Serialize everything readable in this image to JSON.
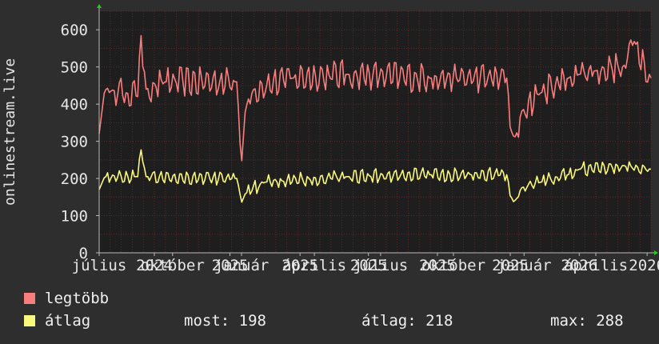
{
  "chart_data": {
    "type": "line",
    "ylabel": "onlinestream.live",
    "ylim": [
      0,
      650
    ],
    "yticks": [
      0,
      100,
      200,
      300,
      400,
      500,
      600
    ],
    "grid": true,
    "xticks": [
      {
        "label": "július",
        "pos": 0.0
      },
      {
        "label": "október",
        "pos": 0.133
      },
      {
        "label": "2024",
        "pos": 0.1
      },
      {
        "label": "január",
        "pos": 0.258
      },
      {
        "label": "2025",
        "pos": 0.237
      },
      {
        "label": "április",
        "pos": 0.39
      },
      {
        "label": "2025",
        "pos": 0.364
      },
      {
        "label": "július",
        "pos": 0.51
      },
      {
        "label": "2025",
        "pos": 0.488
      },
      {
        "label": "október",
        "pos": 0.642
      },
      {
        "label": "2025",
        "pos": 0.613
      },
      {
        "label": "január",
        "pos": 0.77
      },
      {
        "label": "2025",
        "pos": 0.745
      },
      {
        "label": "április",
        "pos": 0.9
      },
      {
        "label": "2026",
        "pos": 0.87
      },
      {
        "label": "2026",
        "pos": 0.993
      }
    ],
    "series": [
      {
        "name": "legtöbb",
        "color": "#f87e7e",
        "keypoints": [
          [
            0,
            320
          ],
          [
            0.01,
            440
          ],
          [
            0.05,
            430
          ],
          [
            0.07,
            420
          ],
          [
            0.075,
            600
          ],
          [
            0.085,
            440
          ],
          [
            0.12,
            460
          ],
          [
            0.25,
            460
          ],
          [
            0.255,
            300
          ],
          [
            0.258,
            240
          ],
          [
            0.265,
            390
          ],
          [
            0.28,
            440
          ],
          [
            0.35,
            470
          ],
          [
            0.45,
            480
          ],
          [
            0.6,
            470
          ],
          [
            0.74,
            470
          ],
          [
            0.745,
            330
          ],
          [
            0.755,
            310
          ],
          [
            0.765,
            380
          ],
          [
            0.8,
            430
          ],
          [
            0.85,
            470
          ],
          [
            0.87,
            480
          ],
          [
            0.9,
            490
          ],
          [
            0.95,
            500
          ],
          [
            0.97,
            570
          ],
          [
            1.0,
            470
          ]
        ],
        "noise": 45
      },
      {
        "name": "átlag",
        "color": "#f8f87e",
        "keypoints": [
          [
            0,
            170
          ],
          [
            0.01,
            205
          ],
          [
            0.07,
            205
          ],
          [
            0.075,
            285
          ],
          [
            0.085,
            205
          ],
          [
            0.25,
            200
          ],
          [
            0.258,
            135
          ],
          [
            0.265,
            160
          ],
          [
            0.3,
            190
          ],
          [
            0.45,
            205
          ],
          [
            0.6,
            210
          ],
          [
            0.74,
            210
          ],
          [
            0.745,
            150
          ],
          [
            0.755,
            140
          ],
          [
            0.765,
            175
          ],
          [
            0.8,
            190
          ],
          [
            0.85,
            210
          ],
          [
            0.87,
            225
          ],
          [
            0.95,
            235
          ],
          [
            1.0,
            225
          ]
        ],
        "noise": 22
      }
    ]
  },
  "legend": [
    {
      "label": "legtöbb",
      "color": "#f87e7e"
    },
    {
      "label": "átlag",
      "color": "#f8f87e"
    }
  ],
  "stats": {
    "now_label": "most:",
    "now_value": "198",
    "avg_label": "átlag:",
    "avg_value": "218",
    "max_label": "max:",
    "max_value": "288"
  },
  "colors": {
    "background": "#2e2e2e",
    "plot_background": "#1e1e1e",
    "grid": "#5a2a2a",
    "axis": "#bbbbbb"
  }
}
